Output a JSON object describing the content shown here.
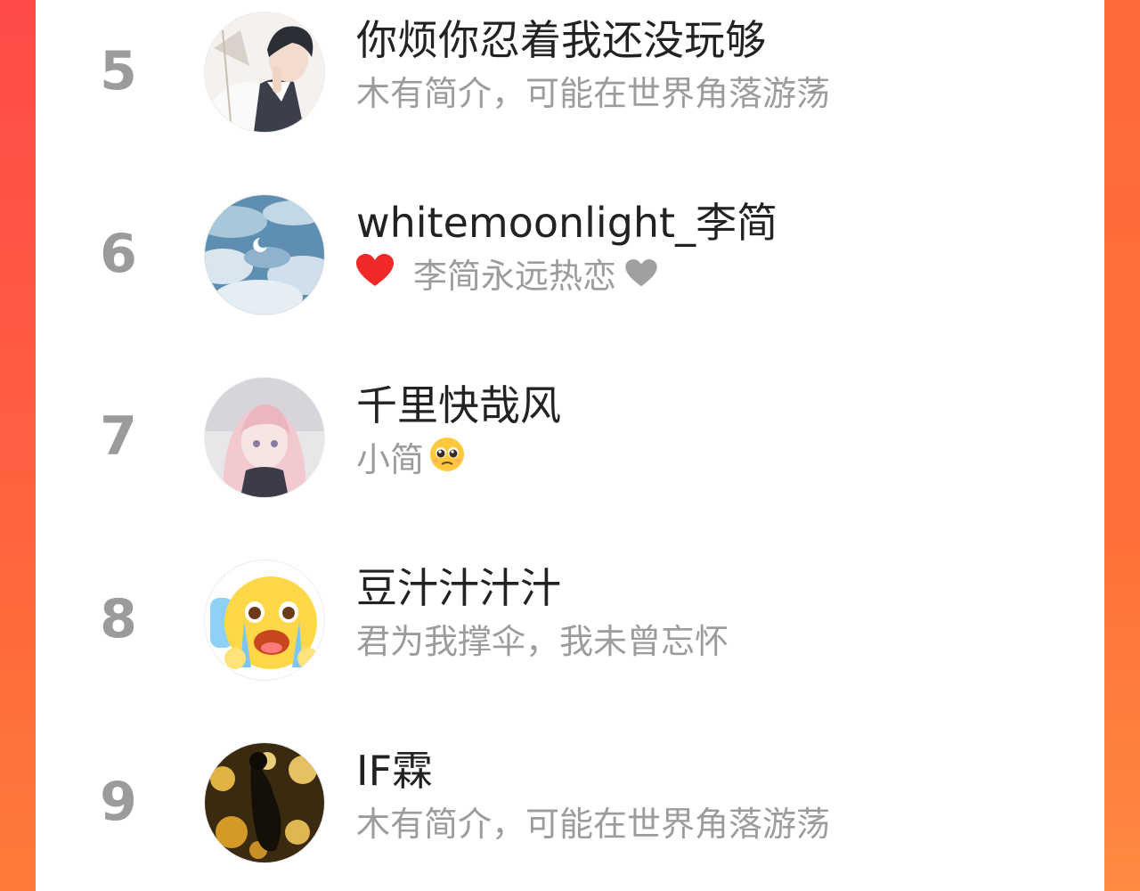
{
  "ranking": {
    "items": [
      {
        "rank": "5",
        "name": "你烦你忍着我还没玩够",
        "bio": "木有简介，可能在世界角落游荡",
        "avatar_icon": "anime-boy-avatar"
      },
      {
        "rank": "6",
        "name": "whitemoonlight_李简",
        "bio": "李简永远热恋",
        "bio_prefix_icon": "red-heart-icon",
        "bio_suffix_icon": "grey-heart-icon",
        "avatar_icon": "blue-clouds-moon-avatar"
      },
      {
        "rank": "7",
        "name": "千里快哉风",
        "bio": "小简",
        "bio_suffix_icon": "pleading-face-emoji",
        "avatar_icon": "anime-girl-avatar"
      },
      {
        "rank": "8",
        "name": "豆汁汁汁汁",
        "bio": "君为我撑伞，我未曾忘怀",
        "avatar_icon": "crying-emoji-avatar"
      },
      {
        "rank": "9",
        "name": "IF霖",
        "bio": "木有简介，可能在世界角落游荡",
        "avatar_icon": "golden-lights-avatar"
      }
    ]
  },
  "colors": {
    "background_gradient_start": "#ff4a48",
    "background_gradient_end": "#ff7a38",
    "rank_text": "#9b9b9b",
    "name_text": "#222222",
    "bio_text": "#9c9c9c",
    "heart_red": "#f02828",
    "heart_grey": "#a0a0a0"
  }
}
